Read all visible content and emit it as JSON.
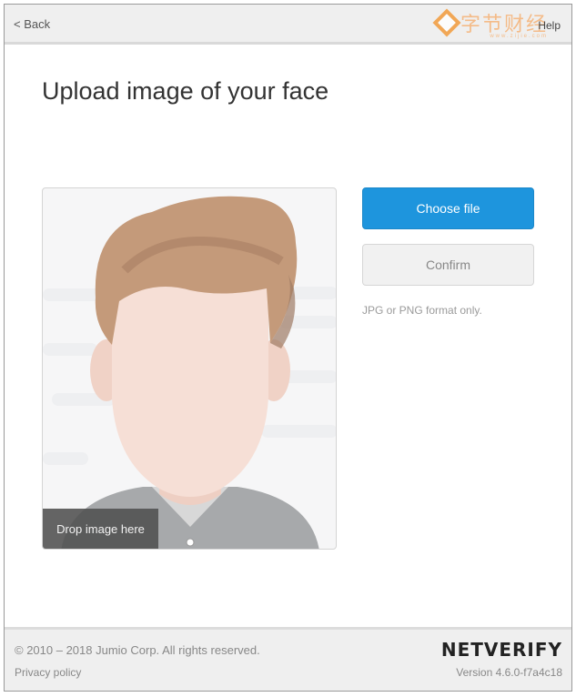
{
  "topbar": {
    "back_label": "< Back",
    "help_label": "Help",
    "watermark_text": "字节财经",
    "watermark_sub": "www.zijie.com"
  },
  "page": {
    "title": "Upload image of your face"
  },
  "dropzone": {
    "label": "Drop image here",
    "illustration": "face-placeholder-icon"
  },
  "actions": {
    "choose_label": "Choose file",
    "confirm_label": "Confirm",
    "format_note": "JPG or PNG format only."
  },
  "footer": {
    "copyright": "© 2010 – 2018 Jumio Corp. All rights reserved.",
    "privacy": "Privacy policy",
    "brand": "NETVERIFY",
    "version": "Version 4.6.0-f7a4c18"
  },
  "colors": {
    "primary_button": "#1e95dd",
    "hair": "#c49a7a",
    "skin": "#f6dfd6",
    "shirt": "#a7a9ab"
  }
}
